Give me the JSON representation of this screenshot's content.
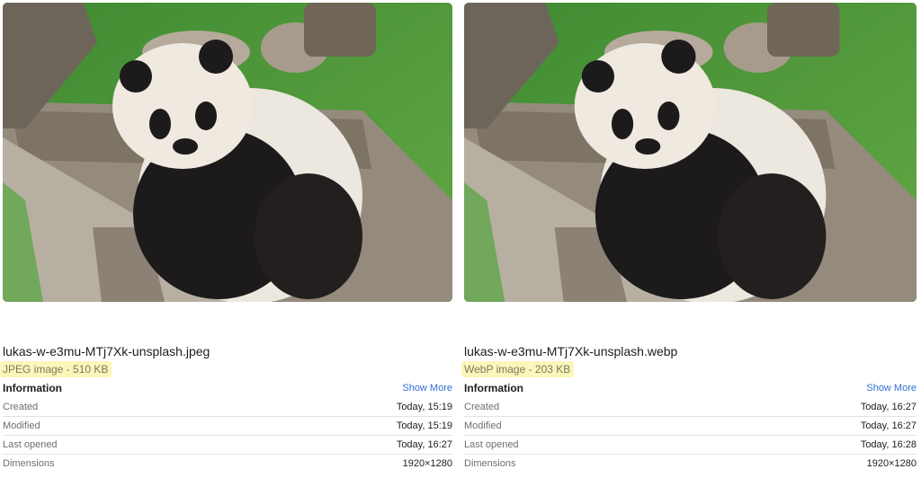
{
  "panels": [
    {
      "filename": "lukas-w-e3mu-MTj7Xk-unsplash.jpeg",
      "kind": "JPEG image - 510 KB",
      "info_title": "Information",
      "show_more": "Show More",
      "rows": [
        {
          "label": "Created",
          "value": "Today, 15:19"
        },
        {
          "label": "Modified",
          "value": "Today, 15:19"
        },
        {
          "label": "Last opened",
          "value": "Today, 16:27"
        },
        {
          "label": "Dimensions",
          "value": "1920×1280"
        }
      ]
    },
    {
      "filename": "lukas-w-e3mu-MTj7Xk-unsplash.webp",
      "kind": "WebP image - 203 KB",
      "info_title": "Information",
      "show_more": "Show More",
      "rows": [
        {
          "label": "Created",
          "value": "Today, 16:27"
        },
        {
          "label": "Modified",
          "value": "Today, 16:27"
        },
        {
          "label": "Last opened",
          "value": "Today, 16:28"
        },
        {
          "label": "Dimensions",
          "value": "1920×1280"
        }
      ]
    }
  ],
  "colors": {
    "highlight": "#fbf6b9",
    "link": "#2f6fd6",
    "grass": "#4f9a3c",
    "panda_black": "#1c1a1b",
    "panda_white": "#ece7df",
    "wood": "#8d8475"
  }
}
